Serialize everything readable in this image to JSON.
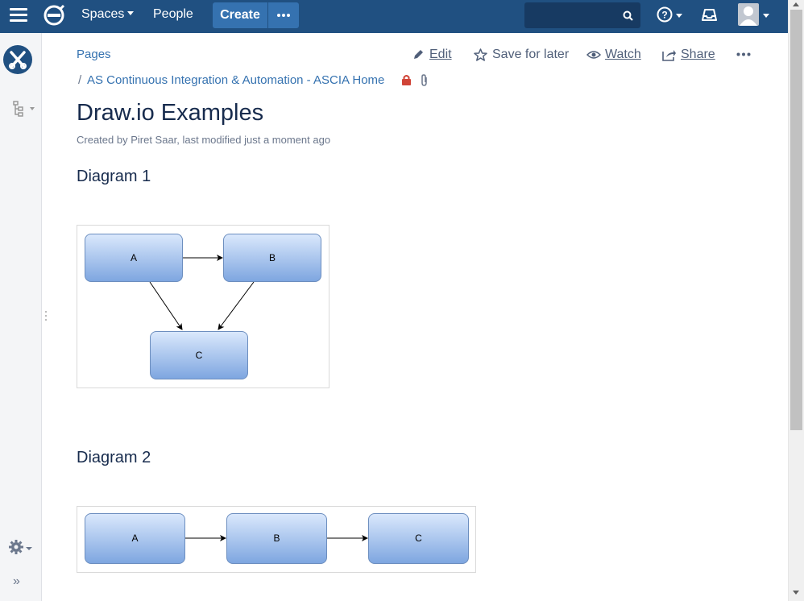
{
  "topnav": {
    "spaces_label": "Spaces",
    "people_label": "People",
    "create_label": "Create"
  },
  "page": {
    "breadcrumb_root": "Pages",
    "breadcrumb_separator": "/",
    "breadcrumb_home": "AS Continuous Integration & Automation - ASCIA Home",
    "title": "Draw.io Examples",
    "byline": "Created by Piret Saar, last modified just a moment ago"
  },
  "actions": {
    "edit": "Edit",
    "save_for_later": "Save for later",
    "watch": "Watch",
    "share": "Share"
  },
  "sections": {
    "diagram1_heading": "Diagram 1",
    "diagram2_heading": "Diagram 2"
  },
  "diagram1": {
    "nodes": [
      "A",
      "B",
      "C"
    ],
    "edges": [
      [
        "A",
        "B"
      ],
      [
        "A",
        "C"
      ],
      [
        "B",
        "C"
      ]
    ]
  },
  "diagram2": {
    "nodes": [
      "A",
      "B",
      "C"
    ],
    "edges": [
      [
        "A",
        "B"
      ],
      [
        "B",
        "C"
      ]
    ]
  },
  "colors": {
    "header": "#205081",
    "link": "#3572b0",
    "node_fill_top": "#dae8fc",
    "node_fill_bottom": "#7ea6e0",
    "node_stroke": "#6c8ebf",
    "lock": "#d04437"
  },
  "icons": [
    "menu-icon",
    "app-logo-icon",
    "ellipsis-icon",
    "search-icon",
    "help-icon",
    "notifications-icon",
    "user-avatar-icon",
    "space-logo-icon",
    "page-tree-icon",
    "pencil-icon",
    "star-icon",
    "eye-icon",
    "share-icon",
    "lock-icon",
    "paperclip-icon",
    "gear-icon",
    "expand-sidebar-icon"
  ]
}
